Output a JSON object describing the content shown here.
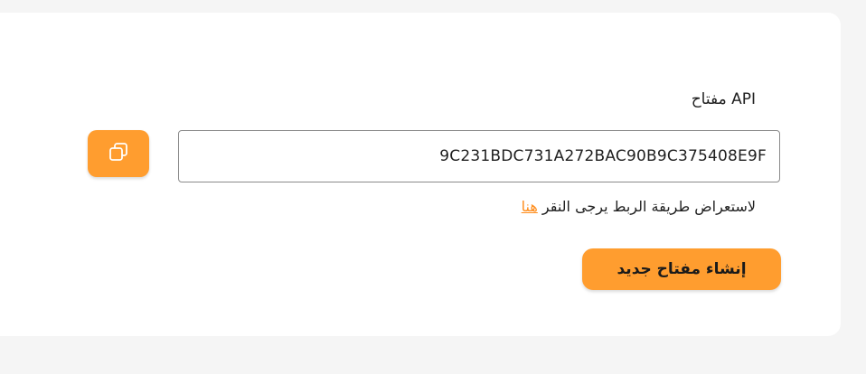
{
  "api_section": {
    "label": "API مفتاح",
    "key_value": "9C231BDC731A272BAC90B9C375408E9F",
    "copy_icon": "copy-icon",
    "hint_text": "لاستعراض طريقة الربط يرجى النقر",
    "hint_link": "هنا",
    "new_key_button": "إنشاء مفتاح جديد"
  },
  "colors": {
    "accent": "#ff9d2f",
    "link": "#ff8c1a",
    "background": "#f5f5f5",
    "card": "#ffffff"
  }
}
